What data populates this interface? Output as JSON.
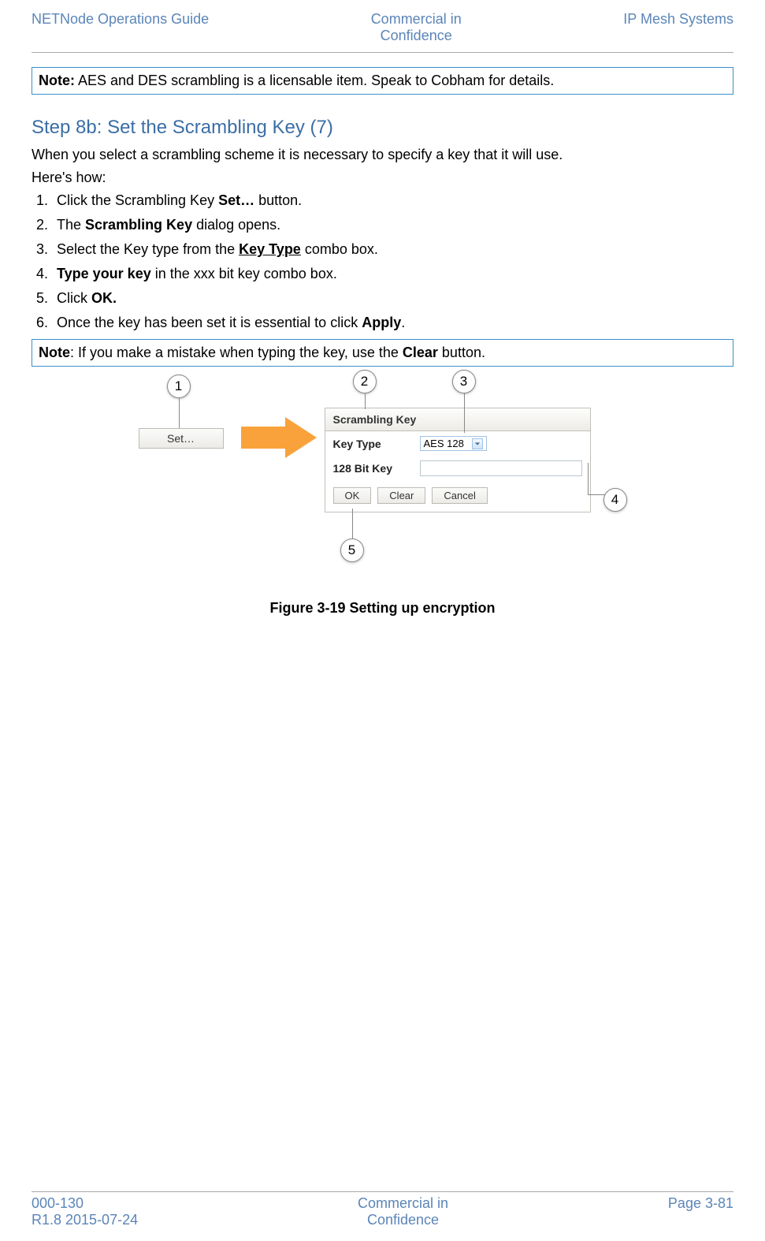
{
  "header": {
    "left": "NETNode Operations Guide",
    "center_line1": "Commercial in",
    "center_line2": "Confidence",
    "right": "IP Mesh Systems"
  },
  "note1": {
    "label": "Note:",
    "text": " AES and DES scrambling is a licensable item. Speak to Cobham for details."
  },
  "step_title": "Step 8b: Set the Scrambling Key (7)",
  "intro": "When you select a scrambling scheme it is necessary to specify a key that it will use.",
  "heres_how": "Here's how:",
  "steps": {
    "s1_a": "Click the Scrambling Key ",
    "s1_b": "Set…",
    "s1_c": " button.",
    "s2_a": "The ",
    "s2_b": "Scrambling Key",
    "s2_c": " dialog opens.",
    "s3_a": "Select the Key type from the ",
    "s3_b": "Key Type",
    "s3_c": " combo box.",
    "s4_a": "Type your key",
    "s4_b": " in the xxx bit key combo box.",
    "s5_a": "Click ",
    "s5_b": "OK.",
    "s6_a": "Once the key has been set it is essential to click ",
    "s6_b": "Apply",
    "s6_c": "."
  },
  "note2": {
    "label": "Note",
    "text": ": If you make a mistake when typing the key, use the ",
    "bold": "Clear",
    "tail": " button."
  },
  "figure": {
    "set_button": "Set…",
    "dialog_title": "Scrambling Key",
    "key_type_label": "Key Type",
    "key_type_value": "AES 128",
    "bitkey_label": "128 Bit Key",
    "ok": "OK",
    "clear": "Clear",
    "cancel": "Cancel",
    "callouts": {
      "c1": "1",
      "c2": "2",
      "c3": "3",
      "c4": "4",
      "c5": "5"
    },
    "caption": "Figure 3-19 Setting up encryption"
  },
  "footer": {
    "left_line1": "000-130",
    "left_line2": "R1.8 2015-07-24",
    "center_line1": "Commercial in",
    "center_line2": "Confidence",
    "right": "Page 3-81"
  }
}
